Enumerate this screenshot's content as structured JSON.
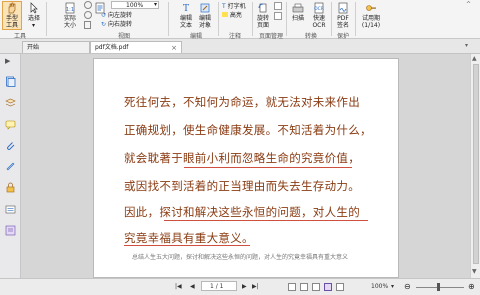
{
  "ribbon": {
    "hand_tool": "手型\n工具",
    "select": "选择",
    "actual_size": "实际\n大小",
    "zoom_value": "100%",
    "rotate_left": "向左旋转",
    "rotate_right": "向右旋转",
    "reflow": "重排",
    "edit_text": "编辑\n文本",
    "edit_object": "编辑\n对象",
    "typewriter": "打字机",
    "highlight": "高亮",
    "rotate_page": "旋转\n页面",
    "scan": "扫描",
    "quick_ocr": "快速\nOCR",
    "pdf_sign": "PDF\n签名",
    "trial_days": "试用期\n(1/14)",
    "groups": {
      "tools": "工具",
      "view": "视图",
      "edit": "编辑",
      "comment": "注释",
      "page_mgmt": "页面管理",
      "convert": "转换",
      "protect": "保护"
    }
  },
  "tabs": [
    {
      "label": "开始"
    },
    {
      "label": "pdf文档.pdf"
    }
  ],
  "document": {
    "lines": [
      "死往何去，不知何为命运，就无法对未来作出",
      "正确规划，使生命健康发展。不知活着为什么，",
      "就会耽著于眼前小利而忽略生命的究竟价值，",
      "或因找不到活着的正当理由而失去生存动力。",
      "因此，探讨和解决这些永恒的问题，对人生的",
      "究竟幸福具有重大意义。"
    ],
    "caption": "总结人生五大问题，探讨和解决这些永恒的问题，对人生的究竟幸福具有重大意义"
  },
  "status": {
    "page_indicator": "1 / 1",
    "zoom": "100%"
  },
  "colors": {
    "text": "#8a3b12",
    "underline": "#d05040",
    "accent": "#2b6cc4"
  }
}
